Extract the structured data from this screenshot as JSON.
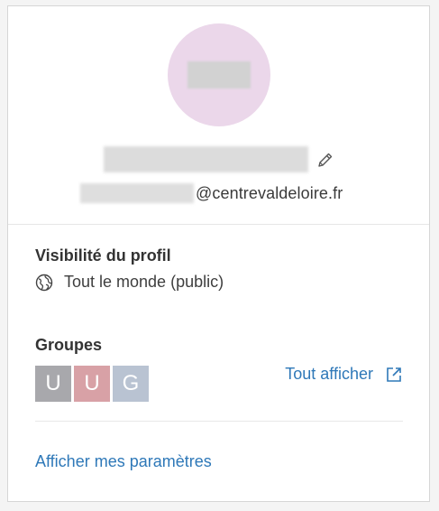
{
  "profile": {
    "email_domain": "@centrevaldeloire.fr"
  },
  "visibility": {
    "title": "Visibilité du profil",
    "value": "Tout le monde (public)"
  },
  "groups": {
    "title": "Groupes",
    "items": [
      {
        "letter": "U",
        "color": "#a8a8ac"
      },
      {
        "letter": "U",
        "color": "#d8a1a6"
      },
      {
        "letter": "G",
        "color": "#b9c3d2"
      }
    ],
    "view_all_label": "Tout afficher"
  },
  "settings_link": "Afficher mes paramètres",
  "colors": {
    "link": "#2e78b8",
    "avatar_bg": "#ebd7ea"
  },
  "icons": {
    "edit": "pencil-icon",
    "visibility": "globe-icon",
    "view_all": "external-link-icon"
  }
}
